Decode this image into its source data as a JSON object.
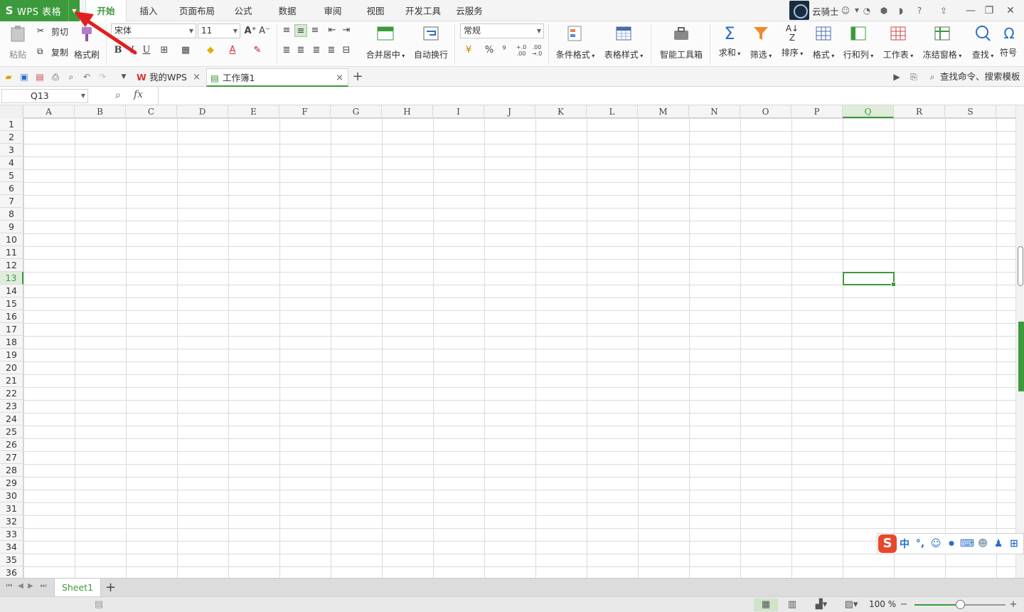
{
  "app": {
    "logo": "S",
    "title": "WPS 表格",
    "brand_color": "#3c9a3c"
  },
  "menu": {
    "tabs": [
      "开始",
      "插入",
      "页面布局",
      "公式",
      "数据",
      "审阅",
      "视图",
      "开发工具",
      "云服务"
    ],
    "active_index": 0
  },
  "user": {
    "name": "云骑士"
  },
  "title_icons": [
    "skin-icon",
    "share-icon",
    "settings-icon",
    "help-icon",
    "upload-icon"
  ],
  "ribbon": {
    "clipboard": {
      "paste": "粘贴",
      "cut": "剪切",
      "copy": "复制",
      "format_painter": "格式刷"
    },
    "font": {
      "name": "宋体",
      "size": "11",
      "bold": "B",
      "italic": "I",
      "underline": "U"
    },
    "number_format": {
      "value": "常规",
      "percent": "%",
      "thousands": "⁹",
      "inc_decimal": "+.0\n.00",
      "dec_decimal": ".00\n→.0"
    },
    "merge_center": "合并居中",
    "wrap_text": "自动换行",
    "conditional_format": "条件格式",
    "table_style": "表格样式",
    "smart_toolbox": "智能工具箱",
    "sum": "求和",
    "filter": "筛选",
    "sort": "排序",
    "format": "格式",
    "row_col": "行和列",
    "worksheet": "工作表",
    "freeze": "冻结窗格",
    "find": "查找",
    "symbol": "符号"
  },
  "doc_tabs": [
    {
      "label": "我的WPS",
      "active": false
    },
    {
      "label": "工作簿1",
      "active": true
    }
  ],
  "search_command": {
    "placeholder": "查找命令、搜索模板"
  },
  "formula_bar": {
    "cell_ref": "Q13",
    "fx": "fx",
    "value": ""
  },
  "sheet": {
    "columns": [
      "A",
      "B",
      "C",
      "D",
      "E",
      "F",
      "G",
      "H",
      "I",
      "J",
      "K",
      "L",
      "M",
      "N",
      "O",
      "P",
      "Q",
      "R",
      "S"
    ],
    "row_count": 36,
    "selected_cell": {
      "col": "Q",
      "row": 13
    }
  },
  "sheet_tabs": {
    "tabs": [
      "Sheet1"
    ],
    "active": "Sheet1"
  },
  "status": {
    "zoom_text": "100 %",
    "zoom_level": 0.5
  },
  "ime": {
    "lang": "中",
    "punct": "°,"
  }
}
